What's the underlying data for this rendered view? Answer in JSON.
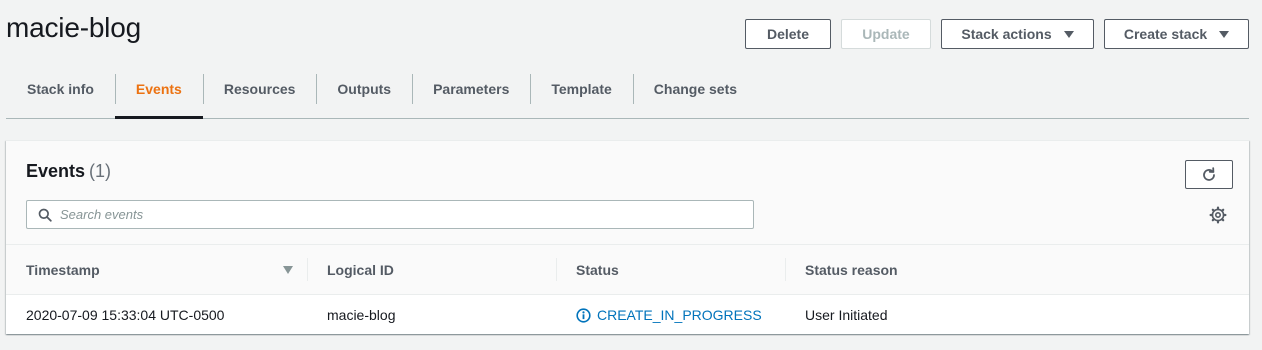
{
  "page": {
    "title": "macie-blog"
  },
  "header_actions": {
    "delete": "Delete",
    "update": "Update",
    "stack_actions": "Stack actions",
    "create_stack": "Create stack"
  },
  "tabs": [
    {
      "label": "Stack info"
    },
    {
      "label": "Events"
    },
    {
      "label": "Resources"
    },
    {
      "label": "Outputs"
    },
    {
      "label": "Parameters"
    },
    {
      "label": "Template"
    },
    {
      "label": "Change sets"
    }
  ],
  "active_tab": "Events",
  "events_panel": {
    "title": "Events",
    "count": "(1)",
    "search_placeholder": "Search events",
    "search_value": ""
  },
  "table": {
    "columns": [
      "Timestamp",
      "Logical ID",
      "Status",
      "Status reason"
    ],
    "rows": [
      {
        "timestamp": "2020-07-09 15:33:04 UTC-0500",
        "logical_id": "macie-blog",
        "status": "CREATE_IN_PROGRESS",
        "status_reason": "User Initiated"
      }
    ]
  },
  "colors": {
    "accent_orange": "#ec7211",
    "link_blue": "#0073bb",
    "text_dark": "#16191f",
    "text_muted": "#545b64"
  },
  "icons": {
    "refresh": "refresh-icon",
    "search": "search-icon",
    "settings": "gear-icon",
    "sort": "sort-down-icon",
    "status": "info-icon",
    "dropdown": "caret-down-icon"
  }
}
